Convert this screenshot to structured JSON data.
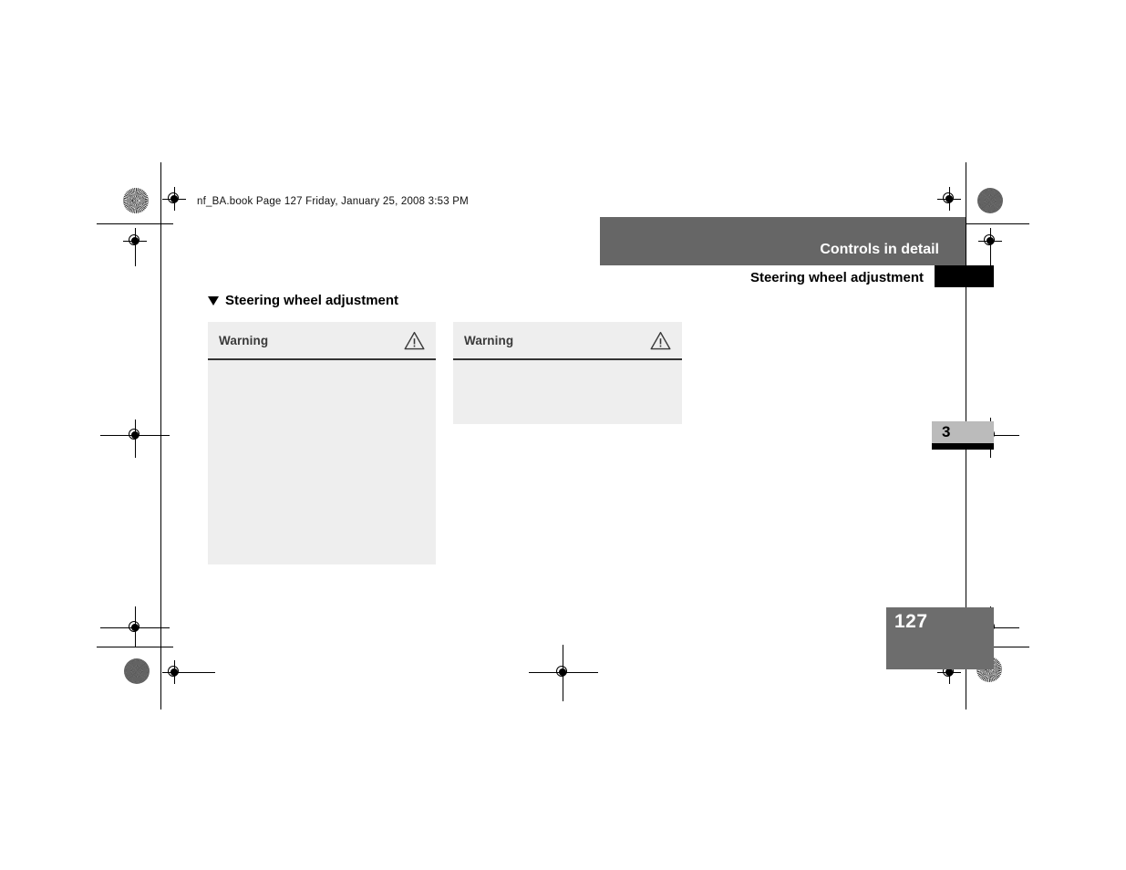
{
  "document": {
    "slug_line": "nf_BA.book  Page 127  Friday, January 25, 2008  3:53 PM",
    "page_number": "127",
    "chapter_number": "3"
  },
  "header": {
    "running_title": "Controls in detail",
    "running_subtitle": "Steering wheel adjustment"
  },
  "section": {
    "bullet_icon": "triangle-down-icon",
    "heading": "Steering wheel adjustment"
  },
  "warnings": [
    {
      "title": "Warning",
      "icon": "warning-triangle-icon",
      "body": ""
    },
    {
      "title": "Warning",
      "icon": "warning-triangle-icon",
      "body": ""
    }
  ],
  "colors": {
    "header_bar": "#666666",
    "header_tab_black": "#000000",
    "warning_box": "#eeeeee",
    "warning_rule": "#333333",
    "chapter_tab": "#bbbbbb",
    "pagenum_block": "#6d6d6d",
    "text": "#000000",
    "white": "#ffffff"
  },
  "marks": {
    "registration_target": "registration-target-icon",
    "starburst": "starburst-registration-icon"
  }
}
